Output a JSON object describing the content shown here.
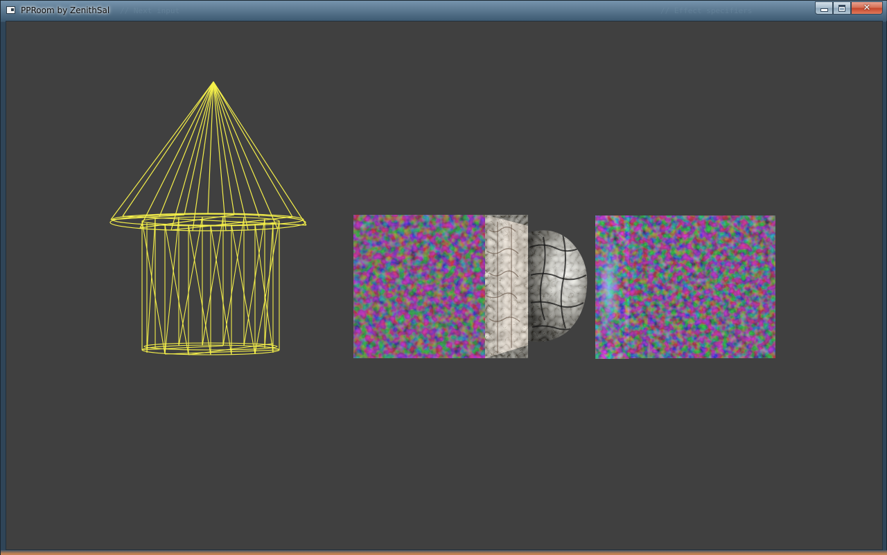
{
  "window": {
    "title": "PPRoom by ZenithSal",
    "background_ghost_text": [
      "// Next input",
      "// Effect specifiers"
    ],
    "caption_buttons": {
      "minimize_icon": "minimize-icon",
      "maximize_icon": "maximize-icon",
      "close_icon": "close-icon"
    }
  },
  "viewport": {
    "background_color": "#404040",
    "objects": [
      {
        "name": "wireframe-cone-roof",
        "color": "#f5f04a"
      },
      {
        "name": "wireframe-cylinder",
        "color": "#f5f04a"
      },
      {
        "name": "textured-cube-left",
        "texture": "multicolor-noise"
      },
      {
        "name": "textured-sphere",
        "texture": "stone-tiles"
      },
      {
        "name": "textured-cube-right",
        "texture": "multicolor-noise"
      }
    ]
  }
}
